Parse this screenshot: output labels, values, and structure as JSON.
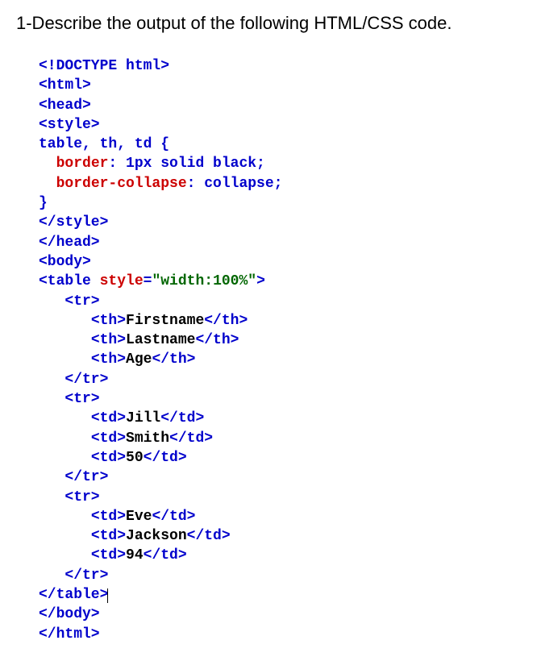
{
  "question": "1-Describe the output of the following HTML/CSS code.",
  "code": {
    "l1": {
      "a": "<!DOCTYPE html>"
    },
    "l2": {
      "a": "<html>"
    },
    "l3": {
      "a": "<head>"
    },
    "l4": {
      "a": "<style>"
    },
    "l5": {
      "a": "table, th, td {"
    },
    "l6": {
      "a": "border",
      "b": ": 1px solid black;"
    },
    "l7": {
      "a": "border-collapse",
      "b": ": collapse;"
    },
    "l8": {
      "a": "}"
    },
    "l9": {
      "a": "</style>"
    },
    "l10": {
      "a": "</head>"
    },
    "l11": {
      "a": "<body>"
    },
    "l12": {
      "a": "<table ",
      "b": "style",
      "c": "=",
      "d": "\"width:100%\"",
      "e": ">"
    },
    "l13": {
      "a": "<tr>"
    },
    "l14": {
      "a": "<th>",
      "b": "Firstname",
      "c": "</th>"
    },
    "l15": {
      "a": "<th>",
      "b": "Lastname",
      "c": "</th>"
    },
    "l16": {
      "a": "<th>",
      "b": "Age",
      "c": "</th>"
    },
    "l17": {
      "a": "</tr>"
    },
    "l18": {
      "a": "<tr>"
    },
    "l19": {
      "a": "<td>",
      "b": "Jill",
      "c": "</td>"
    },
    "l20": {
      "a": "<td>",
      "b": "Smith",
      "c": "</td>"
    },
    "l21": {
      "a": "<td>",
      "b": "50",
      "c": "</td>"
    },
    "l22": {
      "a": "</tr>"
    },
    "l23": {
      "a": "<tr>"
    },
    "l24": {
      "a": "<td>",
      "b": "Eve",
      "c": "</td>"
    },
    "l25": {
      "a": "<td>",
      "b": "Jackson",
      "c": "</td>"
    },
    "l26": {
      "a": "<td>",
      "b": "94",
      "c": "</td>"
    },
    "l27": {
      "a": "</tr>"
    },
    "l28": {
      "a": "</table>"
    },
    "l29": {
      "a": "</body>"
    },
    "l30": {
      "a": "</html>"
    }
  }
}
